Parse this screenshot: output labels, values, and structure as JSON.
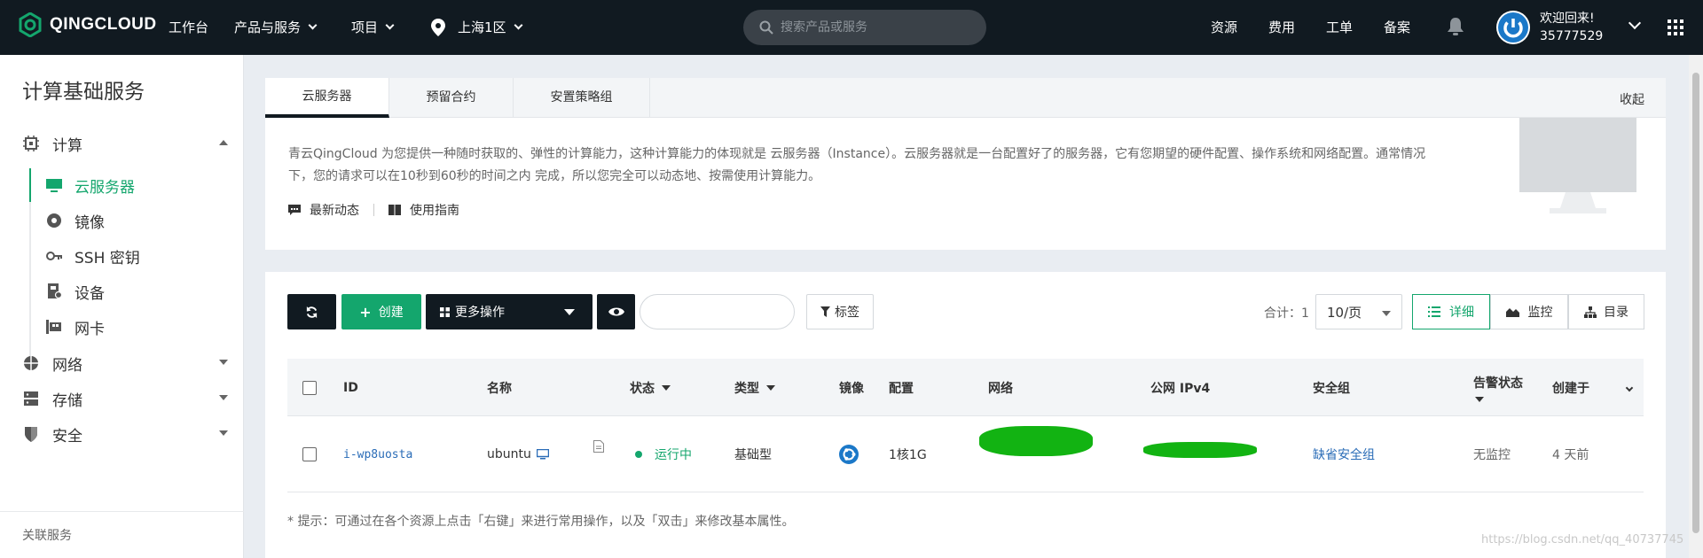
{
  "topbar": {
    "logo_text": "QINGCLOUD",
    "nav": [
      {
        "label": "工作台"
      },
      {
        "label": "产品与服务"
      },
      {
        "label": "项目"
      },
      {
        "label": "上海1区"
      }
    ],
    "search_placeholder": "搜索产品或服务",
    "right_links": [
      {
        "label": "资源"
      },
      {
        "label": "费用"
      },
      {
        "label": "工单"
      },
      {
        "label": "备案"
      }
    ],
    "welcome": "欢迎回来!",
    "account_id": "35777529"
  },
  "sidebar": {
    "title": "计算基础服务",
    "groups": [
      {
        "label": "计算",
        "icon": "chip-icon"
      },
      {
        "label": "网络",
        "icon": "network-icon"
      },
      {
        "label": "存储",
        "icon": "storage-icon"
      },
      {
        "label": "安全",
        "icon": "shield-icon"
      }
    ],
    "items": [
      {
        "label": "云服务器",
        "icon": "monitor-icon"
      },
      {
        "label": "镜像",
        "icon": "image-icon"
      },
      {
        "label": "SSH 密钥",
        "icon": "key-icon"
      },
      {
        "label": "设备",
        "icon": "device-icon"
      },
      {
        "label": "网卡",
        "icon": "nic-icon"
      }
    ],
    "footer": "关联服务"
  },
  "tabs_panel": {
    "tabs": [
      {
        "label": "云服务器"
      },
      {
        "label": "预留合约"
      },
      {
        "label": "安置策略组"
      }
    ],
    "collapse_label": "收起",
    "description": "青云QingCloud 为您提供一种随时获取的、弹性的计算能力，这种计算能力的体现就是 云服务器（Instance）。云服务器就是一台配置好了的服务器，它有您期望的硬件配置、操作系统和网络配置。通常情况下，您的请求可以在10秒到60秒的时间之内 完成，所以您完全可以动态地、按需使用计算能力。",
    "link_news": "最新动态",
    "link_guide": "使用指南"
  },
  "toolbar": {
    "create_label": "创建",
    "more_label": "更多操作",
    "tag_label": "标签",
    "total_label": "合计：1",
    "page_size": "10/页",
    "view_detail": "详细",
    "view_monitor": "监控",
    "view_catalog": "目录"
  },
  "table": {
    "headers": {
      "id": "ID",
      "name": "名称",
      "status": "状态",
      "type": "类型",
      "image": "镜像",
      "config": "配置",
      "network": "网络",
      "public_ip": "公网 IPv4",
      "security_group": "安全组",
      "alarm": "告警状态",
      "created": "创建于"
    },
    "rows": [
      {
        "id": "i-wp8uosta",
        "name": "ubuntu",
        "status": "运行中",
        "type": "基础型",
        "config": "1核1G",
        "security_group": "缺省安全组",
        "alarm": "无监控",
        "created": "4 天前"
      }
    ]
  },
  "hint": "* 提示：可通过在各个资源上点击「右键」来进行常用操作，以及「双击」来修改基本属性。",
  "watermark": "https://blog.csdn.net/qq_40737745",
  "colors": {
    "topbar_bg": "#111a21",
    "accent_green": "#14a66d",
    "link_blue": "#2a6cb7"
  }
}
